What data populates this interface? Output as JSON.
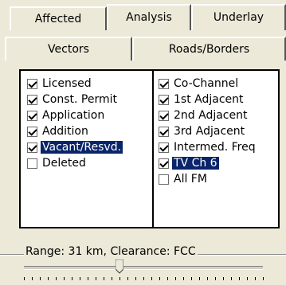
{
  "tabs_row1": [
    {
      "label": "Affected"
    },
    {
      "label": "Analysis"
    },
    {
      "label": "Underlay"
    }
  ],
  "tabs_row2": [
    {
      "label": "Vectors"
    },
    {
      "label": "Roads/Borders"
    }
  ],
  "left_list": [
    {
      "label": "Licensed",
      "checked": true,
      "selected": false
    },
    {
      "label": "Const. Permit",
      "checked": true,
      "selected": false
    },
    {
      "label": "Application",
      "checked": true,
      "selected": false
    },
    {
      "label": "Addition",
      "checked": true,
      "selected": false
    },
    {
      "label": "Vacant/Resvd.",
      "checked": true,
      "selected": true
    },
    {
      "label": "Deleted",
      "checked": false,
      "selected": false
    }
  ],
  "right_list": [
    {
      "label": "Co-Channel",
      "checked": true,
      "selected": false
    },
    {
      "label": "1st Adjacent",
      "checked": true,
      "selected": false
    },
    {
      "label": "2nd Adjacent",
      "checked": true,
      "selected": false
    },
    {
      "label": "3rd Adjacent",
      "checked": true,
      "selected": false
    },
    {
      "label": "Intermed. Freq",
      "checked": true,
      "selected": false
    },
    {
      "label": "TV Ch 6",
      "checked": true,
      "selected": true
    },
    {
      "label": "All FM",
      "checked": false,
      "selected": false
    }
  ],
  "range": {
    "label": "Range: 31 km, Clearance: FCC",
    "slider_fraction": 0.4
  },
  "colors": {
    "selection": "#0a246a",
    "face": "#ece9d8"
  }
}
